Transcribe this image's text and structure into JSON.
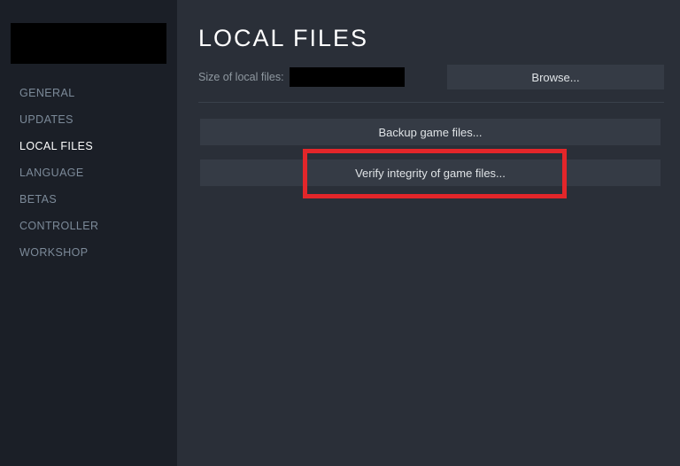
{
  "sidebar": {
    "items": [
      {
        "label": "GENERAL"
      },
      {
        "label": "UPDATES"
      },
      {
        "label": "LOCAL FILES"
      },
      {
        "label": "LANGUAGE"
      },
      {
        "label": "BETAS"
      },
      {
        "label": "CONTROLLER"
      },
      {
        "label": "WORKSHOP"
      }
    ],
    "active_index": 2
  },
  "main": {
    "title": "LOCAL FILES",
    "size_label": "Size of local files:",
    "browse_label": "Browse...",
    "backup_label": "Backup game files...",
    "verify_label": "Verify integrity of game files..."
  }
}
